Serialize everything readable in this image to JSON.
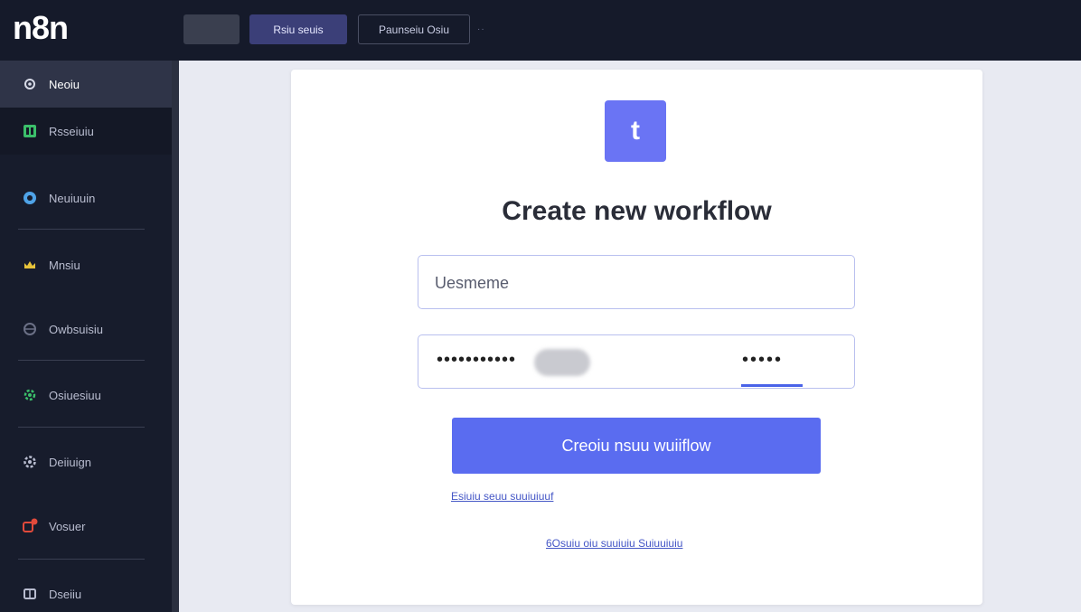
{
  "app": {
    "logo_text": "n8n"
  },
  "topbar": {
    "primary_label": "Rsiu seuis",
    "outline_label": "Paunseiu Osiu",
    "overflow_glyph": "··"
  },
  "sidebar": {
    "items": [
      {
        "label": "Neoiu",
        "icon": "gear-icon",
        "icon_color": "#b9bdd0"
      },
      {
        "label": "Rsseiuiu",
        "icon": "grid-icon",
        "icon_color": "#3bbf6a"
      },
      {
        "label": "Neuiuuin",
        "icon": "globe-icon",
        "icon_color": "#4fa3e8"
      },
      {
        "label": "Mnsiu",
        "icon": "crown-icon",
        "icon_color": "#e7c33a"
      },
      {
        "label": "Owbsuisiu",
        "icon": "hub-icon",
        "icon_color": "#6b7086"
      },
      {
        "label": "Osiuesiuu",
        "icon": "cog-icon",
        "icon_color": "#3bbf6a"
      },
      {
        "label": "Deiiuign",
        "icon": "settings-icon",
        "icon_color": "#b9bdd0"
      },
      {
        "label": "Vosuer",
        "icon": "notification-icon",
        "icon_color": "#e24a3b"
      },
      {
        "label": "Dseiiu",
        "icon": "puzzle-icon",
        "icon_color": "#b9bdd0"
      }
    ]
  },
  "card": {
    "logo_glyph": "t",
    "title": "Create new workflow",
    "username_placeholder": "Uesmeme",
    "password_left": "•••••••••••",
    "password_right": "•••••",
    "submit_label": "Creoiu nsuu wuiiflow",
    "link_1": "Esiuiu seuu suuiuiuuf",
    "link_2": "6Osuiu oiu suuiuiu Suiuuiuiu"
  },
  "colors": {
    "accent": "#5a6cf0",
    "topbar_bg": "#151a2a",
    "sidebar_bg": "#171c2c",
    "page_bg": "#e8eaf2"
  }
}
